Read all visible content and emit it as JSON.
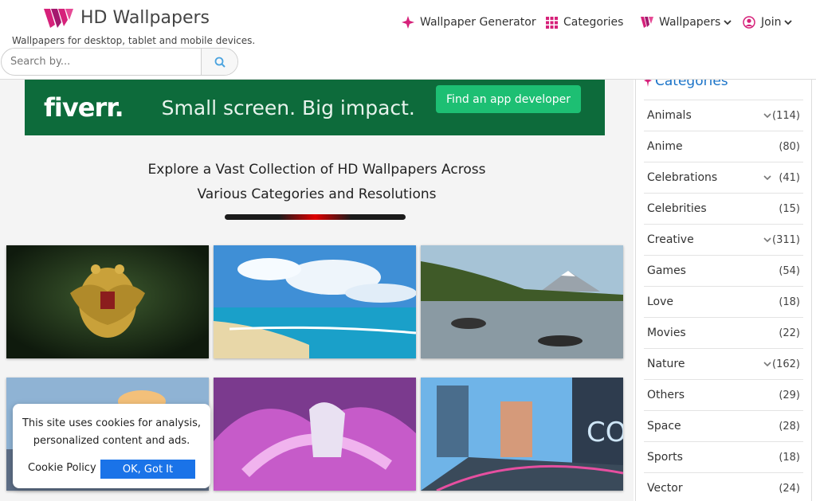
{
  "header": {
    "logo_text": "HD Wallpapers",
    "tagline": "Wallpapers for desktop, tablet and mobile devices.",
    "search_placeholder": "Search by...",
    "nav": {
      "generator": "Wallpaper Generator",
      "categories": "Categories",
      "wallpapers": "Wallpapers",
      "join": "Join"
    }
  },
  "ad": {
    "brand": "fiverr.",
    "headline": "Small screen. Big impact.",
    "cta": "Find an app developer"
  },
  "main": {
    "headline_line1": "Explore a Vast Collection of HD Wallpapers Across",
    "headline_line2": "Various Categories and Resolutions"
  },
  "cookie": {
    "text_line1": "This site uses cookies for analysis,",
    "text_line2": "personalized content and ads.",
    "policy": "Cookie Policy",
    "ok": "OK, Got It"
  },
  "sidebar": {
    "title": "Categories",
    "items": [
      {
        "label": "Animals",
        "count": "(114)",
        "expandable": true
      },
      {
        "label": "Anime",
        "count": "(80)",
        "expandable": false
      },
      {
        "label": "Celebrations",
        "count": "(41)",
        "expandable": true
      },
      {
        "label": "Celebrities",
        "count": "(15)",
        "expandable": false
      },
      {
        "label": "Creative",
        "count": "(311)",
        "expandable": true
      },
      {
        "label": "Games",
        "count": "(54)",
        "expandable": false
      },
      {
        "label": "Love",
        "count": "(18)",
        "expandable": false
      },
      {
        "label": "Movies",
        "count": "(22)",
        "expandable": false
      },
      {
        "label": "Nature",
        "count": "(162)",
        "expandable": true
      },
      {
        "label": "Others",
        "count": "(29)",
        "expandable": false
      },
      {
        "label": "Space",
        "count": "(28)",
        "expandable": false
      },
      {
        "label": "Sports",
        "count": "(18)",
        "expandable": false
      },
      {
        "label": "Vector",
        "count": "(24)",
        "expandable": false
      }
    ]
  },
  "colors": {
    "brand_pink": "#d6217a",
    "link_blue": "#1a73c8",
    "ad_green": "#0d6b3b",
    "cta_green": "#1dbf73",
    "ok_blue": "#1a73e8"
  }
}
